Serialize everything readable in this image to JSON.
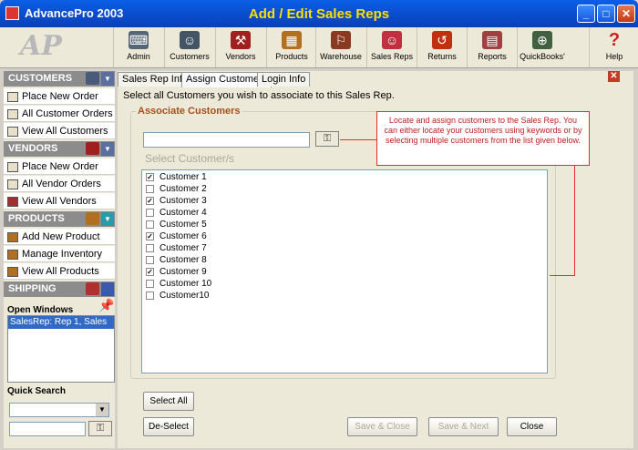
{
  "window": {
    "app_title": "AdvancePro 2003",
    "title": "Add / Edit Sales Reps",
    "controls": [
      "_",
      "□",
      "✕"
    ]
  },
  "toolbar": {
    "items": [
      {
        "label": "Admin",
        "icon": "admin-icon",
        "color": "#556677"
      },
      {
        "label": "Customers",
        "icon": "customers-icon",
        "color": "#445566"
      },
      {
        "label": "Vendors",
        "icon": "vendors-icon",
        "color": "#a02020"
      },
      {
        "label": "Products",
        "icon": "products-icon",
        "color": "#b07020"
      },
      {
        "label": "Warehouse",
        "icon": "warehouse-icon",
        "color": "#8a3a20"
      },
      {
        "label": "Sales Reps",
        "icon": "sales-reps-icon",
        "color": "#c03040"
      },
      {
        "label": "Returns",
        "icon": "returns-icon",
        "color": "#c03010"
      },
      {
        "label": "Reports",
        "icon": "reports-icon",
        "color": "#a04040"
      },
      {
        "label": "QuickBooks'",
        "icon": "quickbooks-icon",
        "color": "#406040"
      },
      {
        "label": "Help",
        "icon": "help-icon",
        "color": "#d02020"
      }
    ]
  },
  "sidebar": {
    "customers": {
      "header": "CUSTOMERS",
      "items": [
        "Place New Order",
        "All Customer Orders",
        "View All Customers"
      ]
    },
    "vendors": {
      "header": "VENDORS",
      "items": [
        "Place New Order",
        "All Vendor Orders",
        "View All Vendors"
      ]
    },
    "products": {
      "header": "PRODUCTS",
      "items": [
        "Add New Product",
        "Manage Inventory",
        "View All Products"
      ]
    },
    "shipping": {
      "header": "SHIPPING"
    },
    "open_windows": {
      "title": "Open Windows",
      "items": [
        "SalesRep: Rep 1, Sales"
      ]
    },
    "quick_search": {
      "title": "Quick Search",
      "select_value": "",
      "input_value": ""
    }
  },
  "tabs": [
    "Sales Rep Info",
    "Assign Customers",
    "Login Info"
  ],
  "active_tab": "Assign Customers",
  "instruction": "Select all Customers you wish to associate to this Sales Rep.",
  "associate": {
    "group_label": "Associate Customers",
    "keyword_value": "",
    "select_label": "Select Customer/s",
    "callout": "Locate and assign customers to the Sales Rep. You can either locate your customers using keywords or by selecting multiple customers from the list given below.",
    "customers": [
      {
        "name": "Customer 1",
        "checked": true
      },
      {
        "name": "Customer 2",
        "checked": false
      },
      {
        "name": "Customer 3",
        "checked": true
      },
      {
        "name": "Customer 4",
        "checked": false
      },
      {
        "name": "Customer 5",
        "checked": false
      },
      {
        "name": "Customer 6",
        "checked": true
      },
      {
        "name": "Customer 7",
        "checked": false
      },
      {
        "name": "Customer 8",
        "checked": false
      },
      {
        "name": "Customer 9",
        "checked": true
      },
      {
        "name": "Customer 10",
        "checked": false
      },
      {
        "name": "Customer10",
        "checked": false
      }
    ]
  },
  "buttons": {
    "select_all": "Select All",
    "deselect": "De-Select",
    "save_close": "Save & Close",
    "save_next": "Save & Next",
    "close": "Close"
  },
  "colors": {
    "title_text": "#ffe000",
    "group_label": "#a54f1c",
    "callout": "#c02020",
    "selection": "#316ac5"
  }
}
